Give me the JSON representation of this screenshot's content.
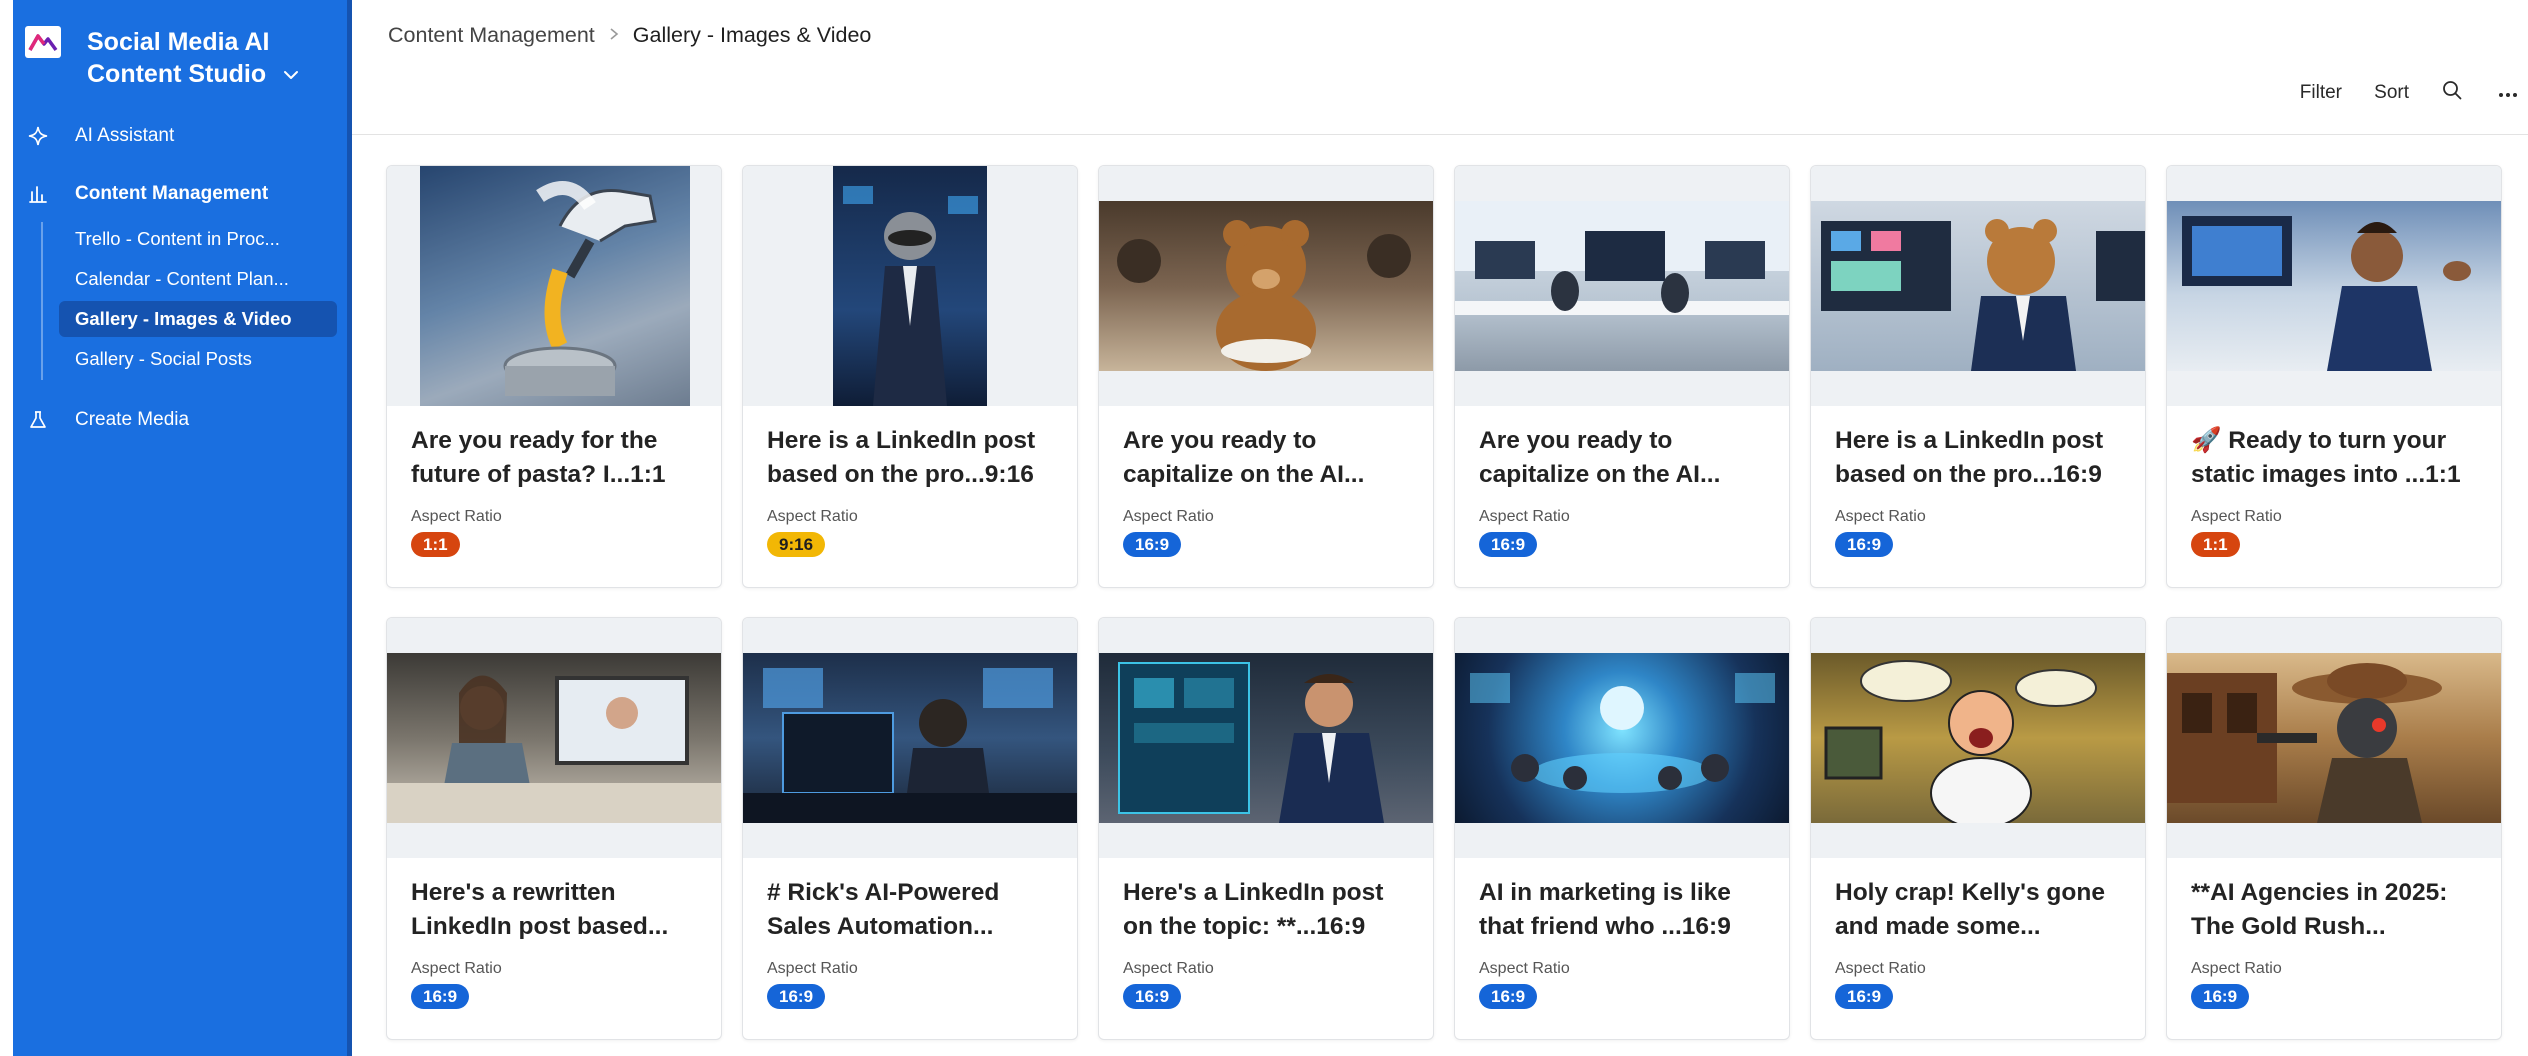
{
  "app": {
    "title": "Social Media AI Content Studio"
  },
  "sidebar": {
    "items": [
      {
        "label": "AI Assistant",
        "icon": "sparkle-icon"
      },
      {
        "label": "Content Management",
        "icon": "bar-chart-icon"
      },
      {
        "label": "Create Media",
        "icon": "flask-icon"
      }
    ],
    "subitems": [
      {
        "label": "Trello - Content in Proc..."
      },
      {
        "label": "Calendar - Content Plan..."
      },
      {
        "label": "Gallery - Images & Video",
        "active": true
      },
      {
        "label": "Gallery - Social Posts"
      }
    ]
  },
  "breadcrumb": {
    "parent": "Content Management",
    "current": "Gallery - Images & Video"
  },
  "toolbar": {
    "filter_label": "Filter",
    "sort_label": "Sort",
    "search_icon": "search-icon",
    "more_icon": "more-horizontal-icon"
  },
  "gallery": {
    "aspect_ratio_label": "Aspect Ratio",
    "badge_colors": {
      "1:1": "#d6450f",
      "9:16": "#f2b705",
      "16:9": "#1565d8"
    },
    "cards": [
      {
        "title": "Are you ready for the future of pasta? I...1:1",
        "ratio": "1:1",
        "scene": "robot arm cooking pasta"
      },
      {
        "title": "Here is a LinkedIn post based on the pro...9:16",
        "ratio": "9:16",
        "scene": "raccoon in business suit"
      },
      {
        "title": "Are you ready to capitalize on the AI...",
        "ratio": "16:9",
        "scene": "teddy bear at dinner table"
      },
      {
        "title": "Are you ready to capitalize on the AI...",
        "ratio": "16:9",
        "scene": "modern office with monitors"
      },
      {
        "title": "Here is a LinkedIn post based on the pro...16:9",
        "ratio": "16:9",
        "scene": "teddy bear presenting dashboards"
      },
      {
        "title": "🚀 Ready to turn your static images into ...1:1",
        "ratio": "1:1",
        "scene": "man gesturing at screens"
      },
      {
        "title": "Here's a rewritten LinkedIn post based...",
        "ratio": "16:9",
        "scene": "man on video call"
      },
      {
        "title": "# Rick's AI-Powered Sales Automation...",
        "ratio": "16:9",
        "scene": "chimpanzee at computer"
      },
      {
        "title": "Here's a LinkedIn post on the topic: **...16:9",
        "ratio": "16:9",
        "scene": "man presenting dashboard"
      },
      {
        "title": "AI in marketing is like that friend who ...16:9",
        "ratio": "16:9",
        "scene": "robot hologram meeting"
      },
      {
        "title": "Holy crap! Kelly's gone and made some...",
        "ratio": "16:9",
        "scene": "cartoon man shouting"
      },
      {
        "title": "**AI Agencies in 2025: The Gold Rush...",
        "ratio": "16:9",
        "scene": "cowboy robot western"
      }
    ]
  }
}
